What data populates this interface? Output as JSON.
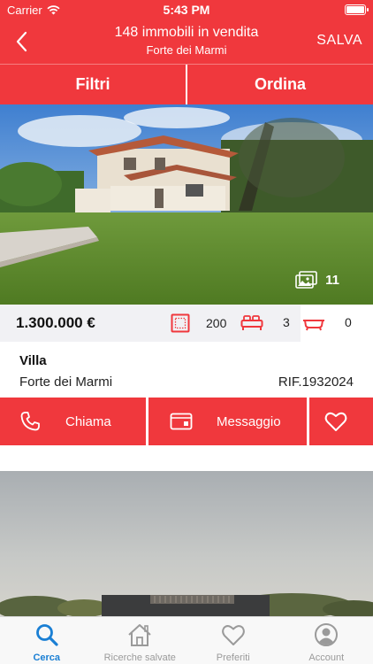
{
  "status_bar": {
    "carrier": "Carrier",
    "time": "5:43 PM"
  },
  "nav": {
    "title": "148 immobili in vendita",
    "subtitle": "Forte dei Marmi",
    "save_label": "SALVA"
  },
  "tabs": {
    "filters": "Filtri",
    "sort": "Ordina"
  },
  "listing": {
    "photo_count": "11",
    "price": "1.300.000 €",
    "area": "200",
    "bedrooms": "3",
    "bathrooms": "0",
    "type": "Villa",
    "city": "Forte dei Marmi",
    "reference": "RIF.1932024"
  },
  "actions": {
    "call": "Chiama",
    "message": "Messaggio"
  },
  "tab_bar": {
    "items": [
      {
        "label": "Cerca",
        "icon": "search-icon",
        "active": true
      },
      {
        "label": "Ricerche salvate",
        "icon": "home-icon",
        "active": false
      },
      {
        "label": "Preferiti",
        "icon": "heart-icon",
        "active": false
      },
      {
        "label": "Account",
        "icon": "account-icon",
        "active": false
      }
    ]
  },
  "colors": {
    "brand_red": "#f0383d",
    "tab_active_blue": "#1a7fd4",
    "tab_inactive_gray": "#9a9a9a"
  }
}
